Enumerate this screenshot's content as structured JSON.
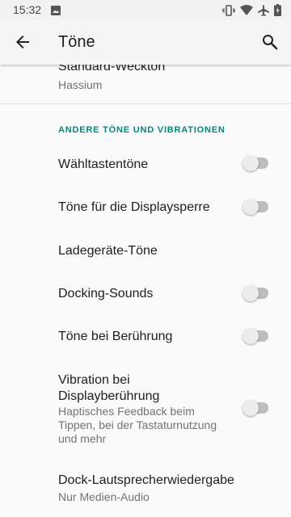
{
  "status_bar": {
    "time": "15:32",
    "icons": [
      "photo-icon",
      "vibrate-icon",
      "wifi-icon",
      "airplane-icon",
      "battery-icon"
    ]
  },
  "app_bar": {
    "title": "Töne",
    "icons": [
      "back-arrow-icon",
      "search-icon"
    ]
  },
  "settings": {
    "standard_alarm": {
      "title": "Standard-Weckton",
      "summary": "Hassium"
    },
    "category_other": "ANDERE TÖNE UND VIBRATIONEN",
    "items": [
      {
        "title": "Wähltastentöne",
        "switch_on": false
      },
      {
        "title": "Töne für die Displaysperre",
        "switch_on": false
      },
      {
        "title": "Ladegeräte-Töne"
      },
      {
        "title": "Docking-Sounds",
        "switch_on": false
      },
      {
        "title": "Töne bei Berührung",
        "switch_on": false
      },
      {
        "title": "Vibration bei Displayberührung",
        "summary": "Haptisches Feedback beim Tippen, bei der Tastaturnutzung und mehr",
        "switch_on": false
      },
      {
        "title": "Dock-Lautsprecherwiedergabe",
        "summary": "Nur Medien-Audio"
      }
    ]
  },
  "colors": {
    "accent": "#00897b",
    "switch_off_track": "#bdbdbd",
    "switch_off_thumb": "#ececec"
  }
}
